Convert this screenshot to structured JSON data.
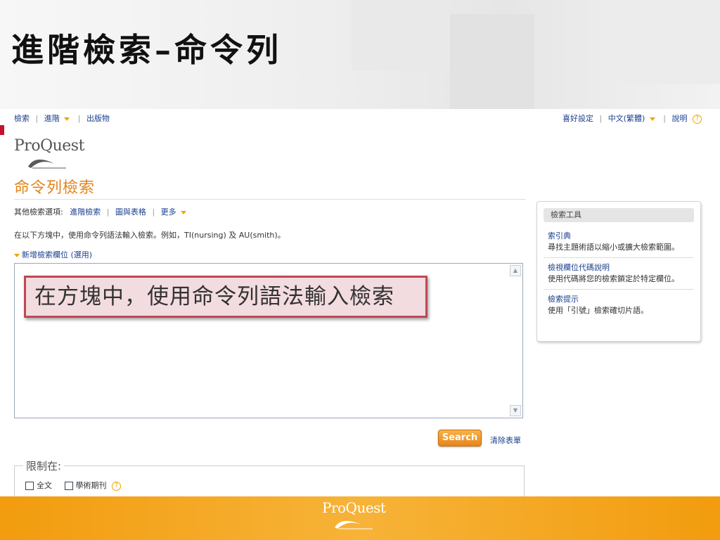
{
  "slide": {
    "title": "進階檢索–命令列"
  },
  "nav": {
    "left": [
      {
        "label": "檢索",
        "dropdown": false
      },
      {
        "label": "進階",
        "dropdown": true
      },
      {
        "label": "出版物",
        "dropdown": false
      }
    ],
    "right": [
      {
        "label": "喜好設定",
        "dropdown": false
      },
      {
        "label": "中文(繁體)",
        "dropdown": true
      },
      {
        "label": "說明",
        "help": true
      }
    ]
  },
  "logo": {
    "text": "ProQuest"
  },
  "page": {
    "heading": "命令列檢索",
    "other_options_label": "其他檢索選項:",
    "other_options": [
      "進階檢索",
      "圖與表格",
      "更多"
    ],
    "instruction": "在以下方塊中，使用命令列語法輸入檢索。例如，TI(nursing) 及 AU(smith)。",
    "add_field": "新增檢索欄位 (選用)"
  },
  "query": {
    "callout": "在方塊中，使用命令列語法輸入檢索"
  },
  "actions": {
    "search": "Search",
    "clear": "清除表單"
  },
  "limit": {
    "legend": "限制在:",
    "options": [
      "全文",
      "學術期刊"
    ]
  },
  "tools": {
    "header": "檢索工具",
    "items": [
      {
        "title": "索引典",
        "desc": "尋找主題術語以縮小或擴大檢索範圍。"
      },
      {
        "title": "檢視欄位代碼說明",
        "desc": "使用代碼將您的檢索鎖定於特定欄位。"
      },
      {
        "title": "檢索提示",
        "desc": "使用「引號」檢索確切片語。"
      }
    ]
  },
  "footer": {
    "logo_text": "ProQuest"
  },
  "colors": {
    "accent_orange": "#e2841a",
    "link_blue": "#1a3f8f",
    "callout_border": "#c04855",
    "footer_orange": "#f29c0e"
  }
}
